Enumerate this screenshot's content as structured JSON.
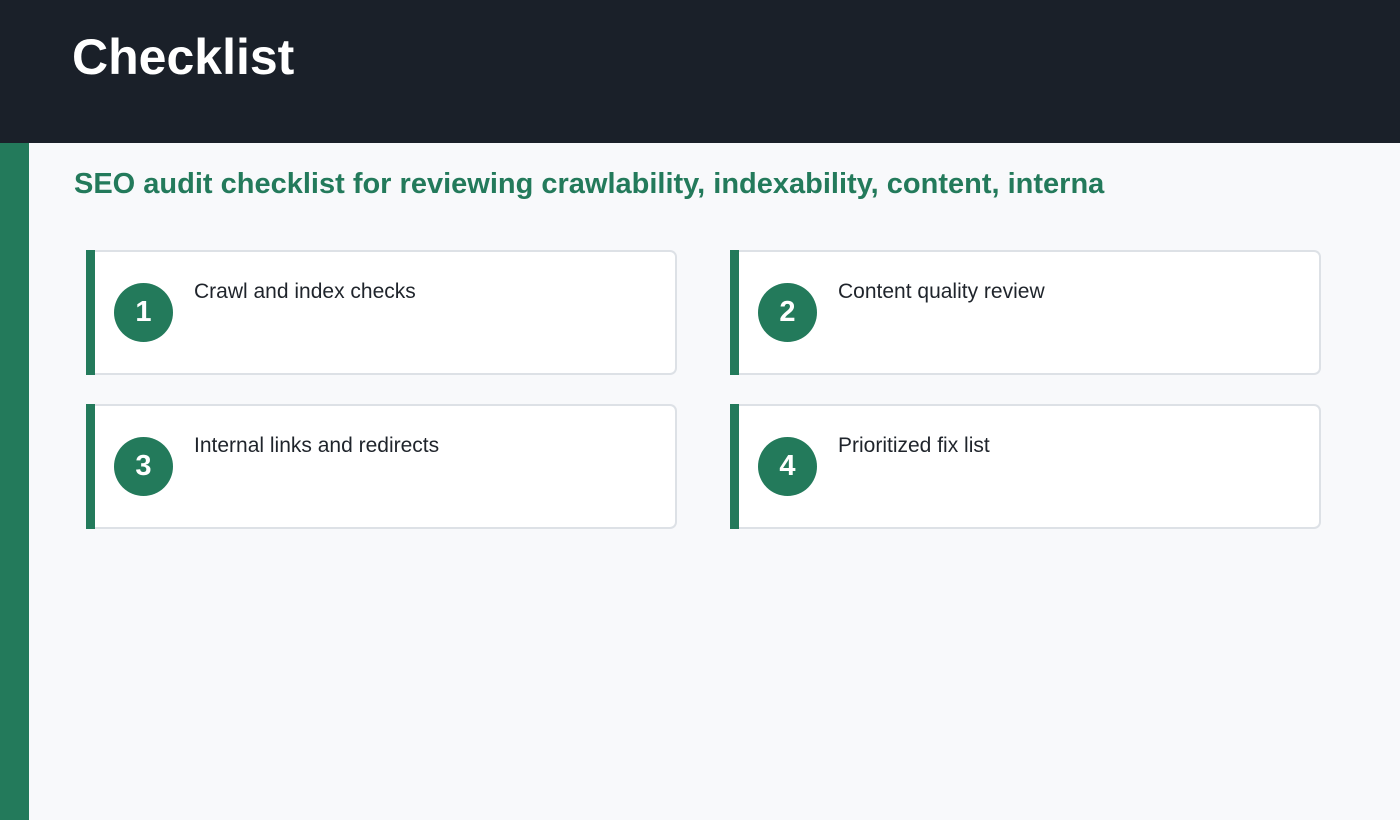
{
  "header": {
    "title": "Checklist"
  },
  "subtitle": "SEO audit checklist for reviewing crawlability, indexability, content, interna",
  "items": [
    {
      "number": "1",
      "label": "Crawl and index checks"
    },
    {
      "number": "2",
      "label": "Content quality review"
    },
    {
      "number": "3",
      "label": "Internal links and redirects"
    },
    {
      "number": "4",
      "label": "Prioritized fix list"
    }
  ],
  "colors": {
    "header_bg": "#1a2029",
    "accent": "#237a5b",
    "page_bg": "#f8f9fb",
    "card_border": "#dde1e6"
  }
}
